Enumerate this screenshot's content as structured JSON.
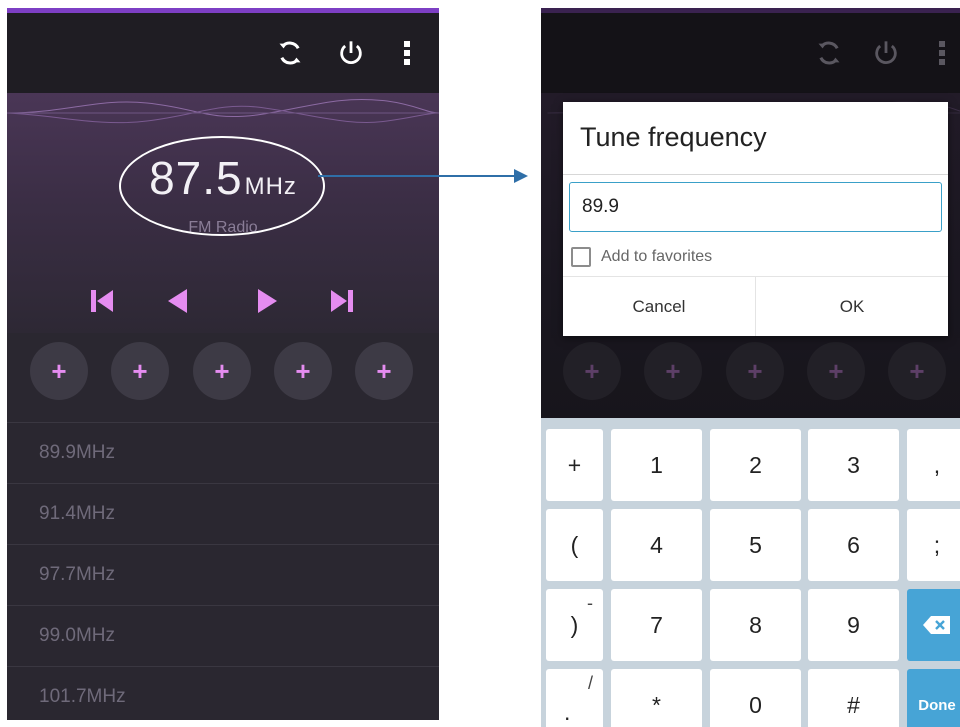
{
  "left_screen": {
    "toolbar": {
      "refresh_icon": "refresh-icon",
      "power_icon": "power-icon",
      "menu_icon": "more-vert-icon"
    },
    "current": {
      "frequency": "87.5",
      "unit": "MHz",
      "label": "FM Radio"
    },
    "controls": [
      "skip-previous-icon",
      "seek-back-icon",
      "seek-forward-icon",
      "skip-next-icon"
    ],
    "presets": [
      "+",
      "+",
      "+",
      "+",
      "+"
    ],
    "stations": [
      {
        "value": "89.9",
        "unit": "MHz"
      },
      {
        "value": "91.4",
        "unit": "MHz"
      },
      {
        "value": "97.7",
        "unit": "MHz"
      },
      {
        "value": "99.0",
        "unit": "MHz"
      },
      {
        "value": "101.7",
        "unit": "MHz"
      }
    ],
    "accent_color": "#e58cf0"
  },
  "right_screen": {
    "presets": [
      "+",
      "+",
      "+",
      "+",
      "+"
    ],
    "dialog": {
      "title": "Tune frequency",
      "input_value": "89.9",
      "checkbox_label": "Add to favorites",
      "cancel_label": "Cancel",
      "ok_label": "OK"
    },
    "keyboard": {
      "rows": [
        [
          {
            "main": "+"
          },
          {
            "main": "1"
          },
          {
            "main": "2"
          },
          {
            "main": "3"
          },
          {
            "main": ","
          }
        ],
        [
          {
            "main": "("
          },
          {
            "main": "4"
          },
          {
            "main": "5"
          },
          {
            "main": "6"
          },
          {
            "main": ";"
          }
        ],
        [
          {
            "main": ")",
            "sup": "-"
          },
          {
            "main": "7"
          },
          {
            "main": "8"
          },
          {
            "main": "9"
          },
          {
            "main": "backspace-icon"
          }
        ],
        [
          {
            "main": ".",
            "sup": "/"
          },
          {
            "main": "*"
          },
          {
            "main": "0"
          },
          {
            "main": "#"
          },
          {
            "main": "Done"
          }
        ]
      ],
      "accent_color": "#47a4d6"
    }
  }
}
